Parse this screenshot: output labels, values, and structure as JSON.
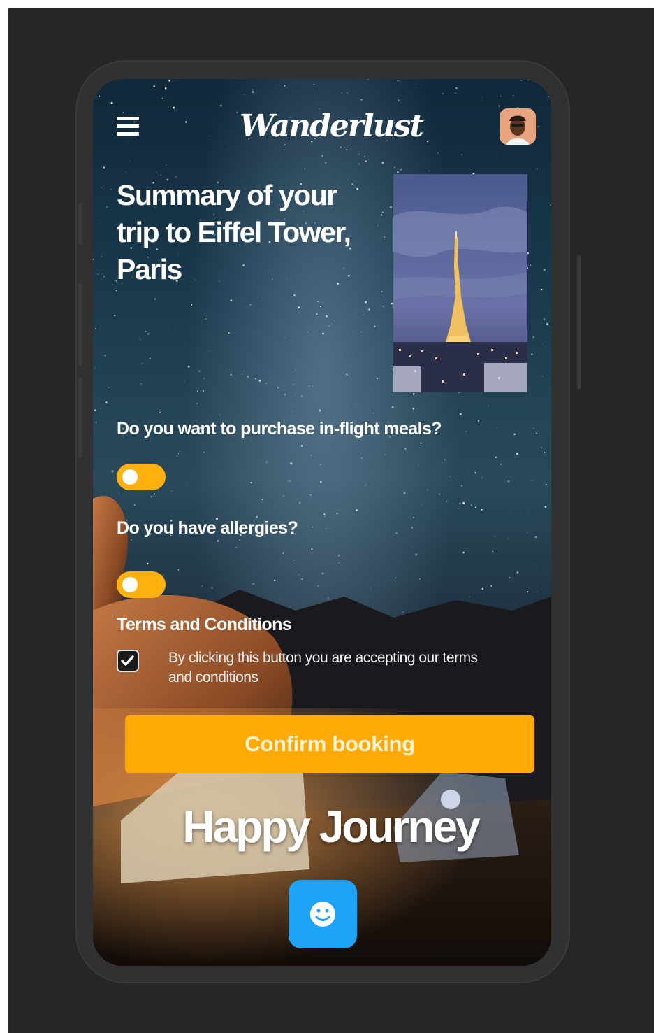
{
  "app": {
    "logo_text": "Wanderlust"
  },
  "summary": {
    "title": "Summary of your trip to Eiffel Tower, Paris"
  },
  "questions": {
    "meals": "Do you want to purchase in-flight meals?",
    "allergies": "Do you have allergies?"
  },
  "terms": {
    "title": "Terms and Conditions",
    "text": "By clicking this button you are accepting our terms and conditions",
    "checked": true
  },
  "actions": {
    "confirm_label": "Confirm booking"
  },
  "footer": {
    "message": "Happy Journey"
  },
  "icons": {
    "menu": "hamburger-menu-icon",
    "profile": "avatar",
    "fab": "smiley-face-icon",
    "check": "checkmark-icon"
  },
  "colors": {
    "accent": "#ffaa06",
    "fab": "#1ea3f6",
    "text": "#ffffff"
  }
}
